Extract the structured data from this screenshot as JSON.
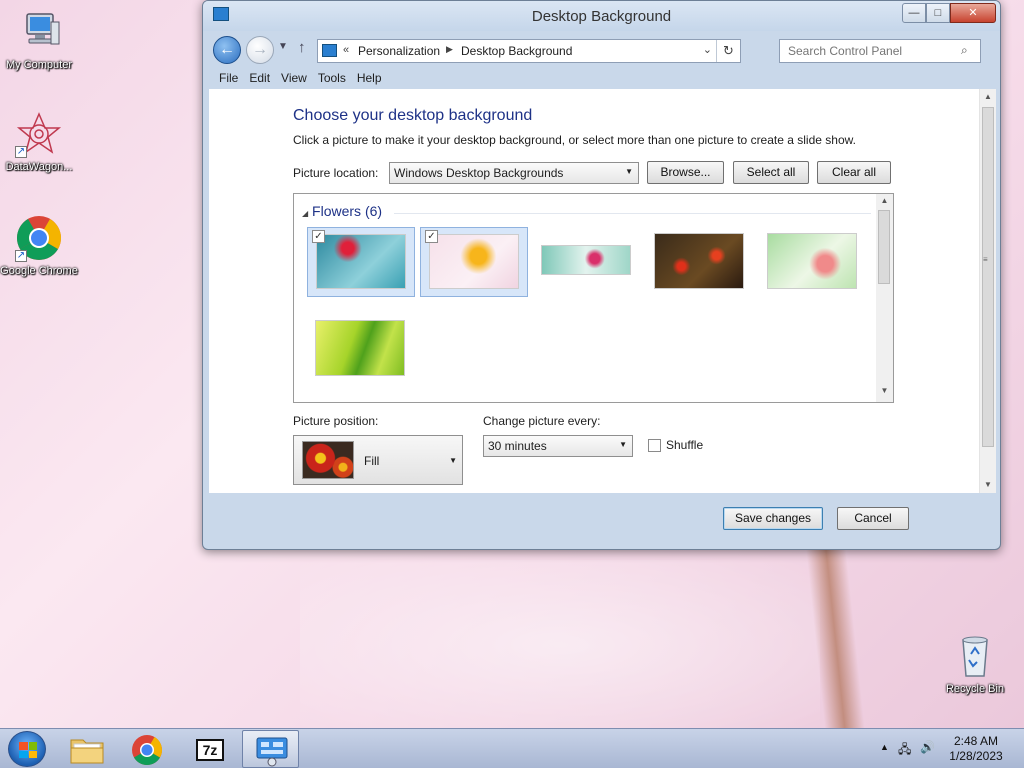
{
  "desktop": {
    "icons": [
      {
        "label": "My Computer"
      },
      {
        "label": "DataWagon..."
      },
      {
        "label": "Google Chrome"
      },
      {
        "label": "Recycle Bin"
      }
    ]
  },
  "window": {
    "title": "Desktop Background",
    "buttons": {
      "minimize": "—",
      "maximize": "□",
      "close": "✕"
    },
    "breadcrumb": {
      "parent": "Personalization",
      "current": "Desktop Background"
    },
    "search": {
      "placeholder": "Search Control Panel"
    },
    "menu": [
      "File",
      "Edit",
      "View",
      "Tools",
      "Help"
    ]
  },
  "main": {
    "heading": "Choose your desktop background",
    "subtitle": "Click a picture to make it your desktop background, or select more than one picture to create a slide show.",
    "picture_location_label": "Picture location:",
    "picture_location_value": "Windows Desktop Backgrounds",
    "browse_label": "Browse...",
    "select_all_label": "Select all",
    "clear_all_label": "Clear all",
    "group_label": "Flowers (6)",
    "thumbnails": [
      {
        "name": "red-flower-on-blue",
        "selected": true,
        "checked": true
      },
      {
        "name": "yellow-daisy-on-pink",
        "selected": true,
        "checked": true
      },
      {
        "name": "pink-flower-on-mint",
        "selected": false,
        "checked": false
      },
      {
        "name": "red-tulips-dark",
        "selected": false,
        "checked": false
      },
      {
        "name": "pink-lily-on-green",
        "selected": false,
        "checked": false
      },
      {
        "name": "green-leaves",
        "selected": false,
        "checked": false
      }
    ],
    "picture_position_label": "Picture position:",
    "picture_position_value": "Fill",
    "change_every_label": "Change picture every:",
    "change_every_value": "30 minutes",
    "shuffle_label": "Shuffle",
    "shuffle_checked": false
  },
  "footer": {
    "save_label": "Save changes",
    "cancel_label": "Cancel"
  },
  "taskbar": {
    "items": [
      "start-button",
      "file-explorer",
      "google-chrome",
      "7-zip",
      "control-panel"
    ],
    "seven_zip_text": "7z",
    "clock_time": "2:48 AM",
    "clock_date": "1/28/2023"
  },
  "colors": {
    "accent": "#1e3287",
    "selection": "#d7e6f9",
    "close_button": "#c7432f"
  }
}
